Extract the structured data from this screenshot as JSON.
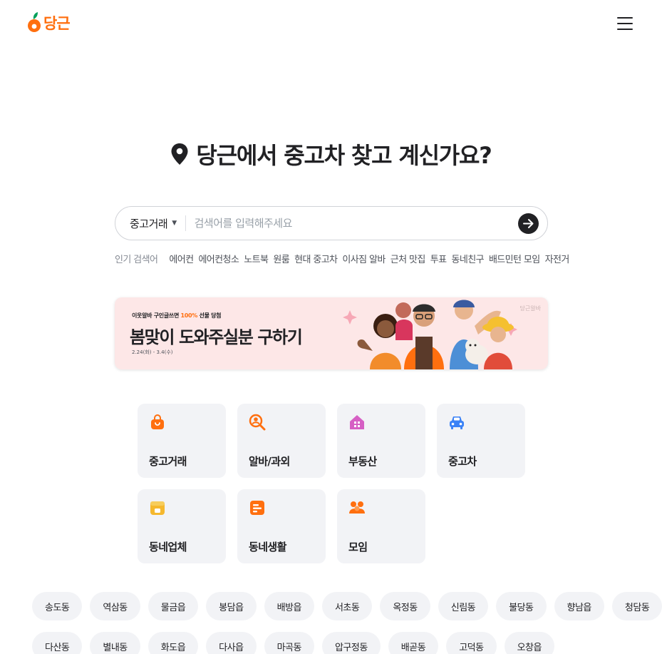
{
  "header": {
    "logo_text": "당근",
    "menu_icon": "hamburger-menu-icon"
  },
  "hero": {
    "title": "당근에서 중고차 찾고 계신가요?",
    "icon": "location-pin-icon"
  },
  "search": {
    "category": "중고거래",
    "placeholder": "검색어를 입력해주세요",
    "value": "",
    "submit_icon": "arrow-right-icon"
  },
  "popular": {
    "label": "인기 검색어",
    "items": [
      "에어컨",
      "에어컨청소",
      "노트북",
      "원룸",
      "현대 중고차",
      "이사짐 알바",
      "근처 맛집",
      "투표",
      "동네친구",
      "배드민턴 모임",
      "자전거"
    ]
  },
  "banner": {
    "eyebrow_prefix": "이웃알바 구인글쓰면 ",
    "eyebrow_accent": "100%",
    "eyebrow_suffix": " 선물 당첨",
    "title": "봄맞이 도와주실분 구하기",
    "date": "2.24(화) - 3.4(수)",
    "brand": "당근알바"
  },
  "services": [
    {
      "label": "중고거래",
      "icon": "shopping-bag-icon",
      "color": "#ff6f0f"
    },
    {
      "label": "알바/과외",
      "icon": "search-person-icon",
      "color": "#ff6f0f"
    },
    {
      "label": "부동산",
      "icon": "house-icon",
      "color": "#d65fc4"
    },
    {
      "label": "중고차",
      "icon": "car-icon",
      "color": "#3b82f6"
    },
    {
      "label": "동네업체",
      "icon": "store-icon",
      "color": "#f5b82e"
    },
    {
      "label": "동네생활",
      "icon": "document-icon",
      "color": "#ff6f0f"
    },
    {
      "label": "모임",
      "icon": "people-icon",
      "color": "#ff6f0f"
    }
  ],
  "neighborhoods": [
    [
      "송도동",
      "역삼동",
      "물금읍",
      "봉담읍",
      "배방읍",
      "서초동",
      "옥정동",
      "신림동",
      "불당동",
      "향남읍",
      "청담동"
    ],
    [
      "다산동",
      "별내동",
      "화도읍",
      "다사읍",
      "마곡동",
      "압구정동",
      "배곧동",
      "고덕동",
      "오창읍"
    ]
  ],
  "colors": {
    "brand": "#ff6f0f",
    "text": "#212124",
    "banner_bg": "#fde7e7",
    "card_bg": "#f2f3f6"
  }
}
